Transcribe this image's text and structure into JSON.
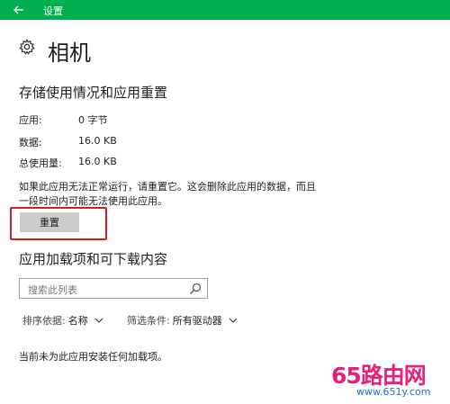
{
  "titlebar": {
    "title": "设置",
    "back_icon": "back-arrow-icon",
    "color": "#00b050"
  },
  "page": {
    "title": "相机",
    "icon": "gear-icon"
  },
  "storage": {
    "heading": "存储使用情况和应用重置",
    "rows": [
      {
        "label": "应用:",
        "value": "0 字节"
      },
      {
        "label": "数据:",
        "value": "16.0 KB"
      },
      {
        "label": "总使用量:",
        "value": "16.0 KB"
      }
    ],
    "description": "如果此应用无法正常运行，请重置它。这会删除此应用的数据，而且一段时间内可能无法使用此应用。",
    "reset_label": "重置",
    "highlight_color": "#e0191b"
  },
  "addons": {
    "heading": "应用加载项和可下载内容",
    "search_placeholder": "搜索此列表",
    "sort_label": "排序依据:",
    "sort_value": "名称",
    "filter_label": "筛选条件:",
    "filter_value": "所有驱动器",
    "empty_message": "当前未为此应用安装任何加载项。"
  },
  "watermark": {
    "text": "65路由网",
    "url": "www.651y.com"
  }
}
